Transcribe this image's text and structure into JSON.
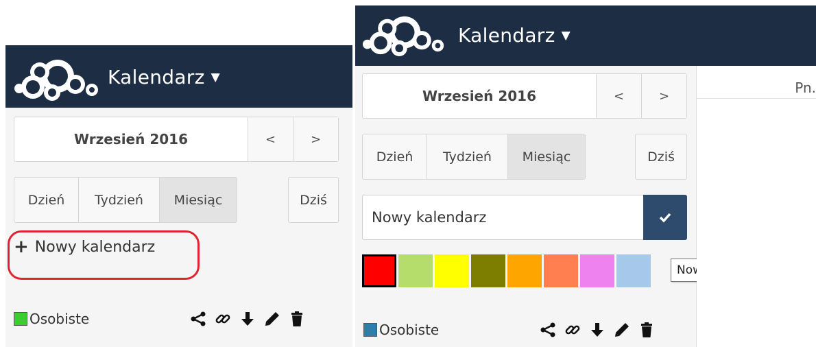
{
  "left_panel": {
    "app_title": "Kalendarz",
    "title_caret": "▼",
    "date_picker": {
      "label": "Wrzesień 2016",
      "prev": "<",
      "next": ">"
    },
    "views": [
      {
        "label": "Dzień",
        "active": false
      },
      {
        "label": "Tydzień",
        "active": false
      },
      {
        "label": "Miesiąc",
        "active": true
      }
    ],
    "today_label": "Dziś",
    "new_calendar": {
      "plus": "+",
      "label": "Nowy kalendarz"
    },
    "calendar": {
      "name": "Osobiste",
      "color": "#3cce2e"
    },
    "actions": [
      "share-icon",
      "link-icon",
      "download-icon",
      "pencil-icon",
      "trash-icon"
    ]
  },
  "right_panel": {
    "app_title": "Kalendarz",
    "title_caret": "▼",
    "date_picker": {
      "label": "Wrzesień 2016",
      "prev": "<",
      "next": ">"
    },
    "views": [
      {
        "label": "Dzień",
        "active": false
      },
      {
        "label": "Tydzień",
        "active": false
      },
      {
        "label": "Miesiąc",
        "active": true
      }
    ],
    "today_label": "Dziś",
    "new_calendar_input": {
      "value": "Nowy kalendarz"
    },
    "confirm_icon": "checkmark-icon",
    "color_palette": [
      "#ff0000",
      "#b5dd6b",
      "#ffff00",
      "#7d7d00",
      "#ffa500",
      "#ff7f50",
      "#ee82ee",
      "#a6c8ea"
    ],
    "selected_color": "#ff0000",
    "calendar": {
      "name": "Osobiste",
      "color": "#2d7ea8"
    },
    "actions": [
      "share-icon",
      "link-icon",
      "download-icon",
      "pencil-icon",
      "trash-icon"
    ],
    "day_header": "Pn.",
    "tooltip": "Nowy kalendarz"
  },
  "colors": {
    "header_bg": "#1d2d44",
    "highlight": "#e0242f",
    "confirm_bg": "#2e4a6d"
  }
}
